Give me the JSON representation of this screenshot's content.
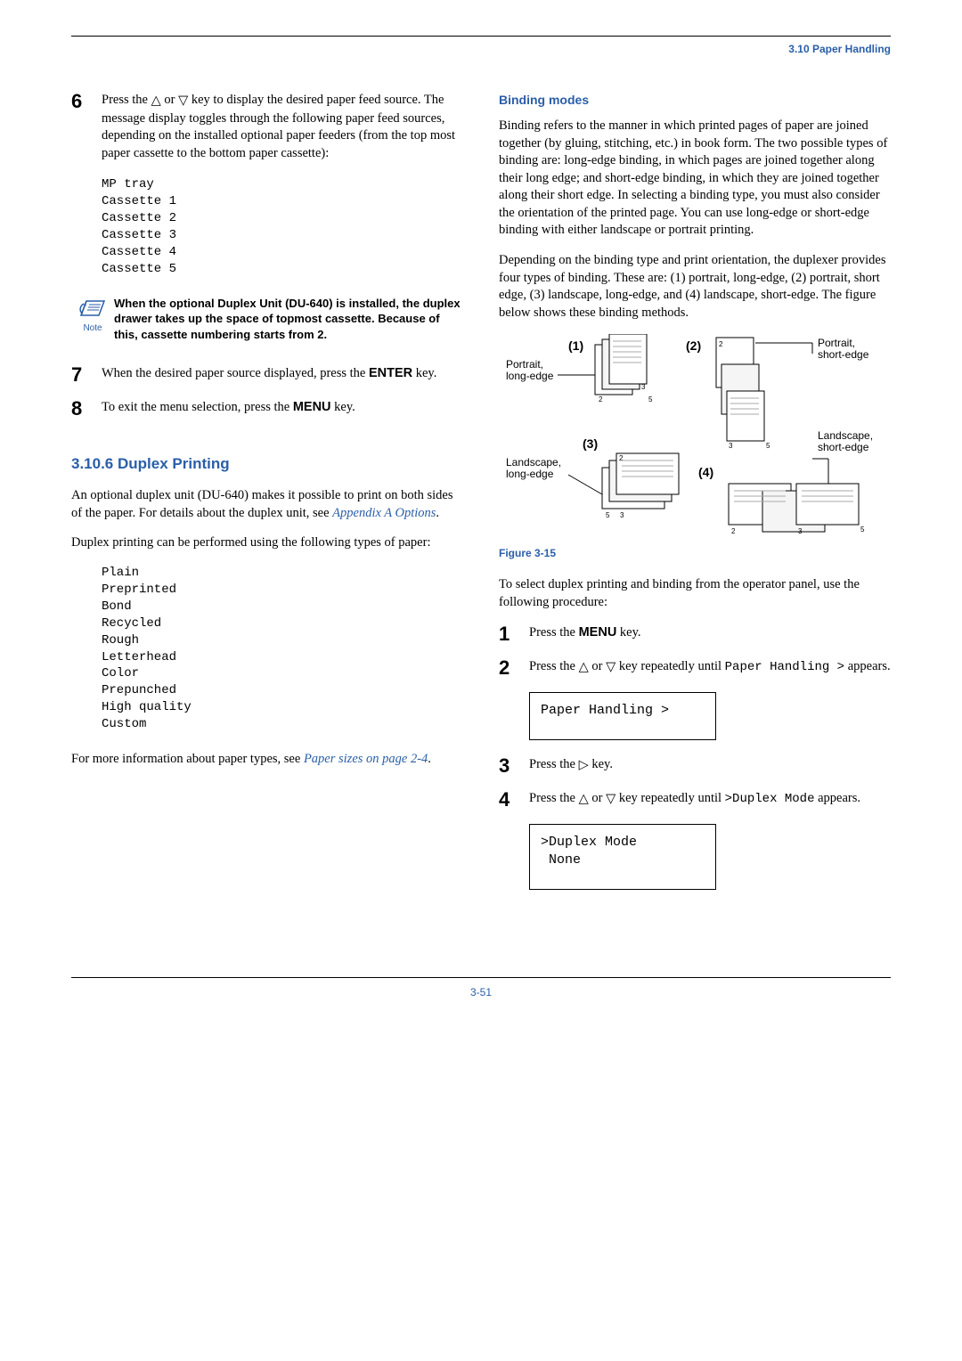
{
  "header": {
    "section": "3.10 Paper Handling"
  },
  "left": {
    "step6": {
      "num": "6",
      "text_a": "Press the ",
      "text_b": " or ",
      "text_c": " key to display the desired paper feed source. The message display toggles through the following paper feed sources, depending on the installed optional paper feeders (from the top most paper cassette to the bottom paper cassette):"
    },
    "feed_sources": "MP tray\nCassette 1\nCassette 2\nCassette 3\nCassette 4\nCassette 5",
    "note": {
      "label": "Note",
      "text": "When the optional Duplex Unit (DU-640) is installed, the duplex drawer takes up the space of topmost cassette. Because of this, cassette numbering starts from 2."
    },
    "step7": {
      "num": "7",
      "text_a": "When the desired paper source displayed, press the ",
      "key": "ENTER",
      "text_b": " key."
    },
    "step8": {
      "num": "8",
      "text_a": "To exit the menu selection, press the ",
      "key": "MENU",
      "text_b": " key."
    },
    "h2": "3.10.6   Duplex Printing",
    "p1_a": "An optional duplex unit (DU-640) makes it possible to print on both sides of the paper. For details about the duplex unit, see ",
    "p1_link": "Appendix A Options",
    "p1_b": ".",
    "p2": "Duplex printing can be performed using the following types of paper:",
    "paper_types": "Plain\nPreprinted\nBond\nRecycled\nRough\nLetterhead\nColor\nPrepunched\nHigh quality\nCustom",
    "p3_a": "For more information about paper types, see ",
    "p3_link": "Paper sizes on page 2-4",
    "p3_b": "."
  },
  "right": {
    "h3": "Binding modes",
    "p1": "Binding refers to the manner in which printed pages of paper are joined together (by gluing, stitching, etc.) in book form. The two possible types of binding are: long-edge binding, in which pages are joined together along their long edge; and short-edge binding, in which they are joined together along their short edge. In selecting a binding type, you must also consider the orientation of the printed page. You can use long-edge or short-edge binding with either landscape or portrait printing.",
    "p2": "Depending on the binding type and print orientation, the duplexer provides four types of binding. These are: (1) portrait, long-edge, (2) portrait, short edge, (3) landscape, long-edge, and (4) landscape, short-edge. The figure below shows these binding methods.",
    "figure": {
      "n1": "(1)",
      "n2": "(2)",
      "n3": "(3)",
      "n4": "(4)",
      "lab1": "Portrait,\nlong-edge",
      "lab2": "Portrait,\nshort-edge",
      "lab3": "Landscape,\nlong-edge",
      "lab4": "Landscape,\nshort-edge",
      "marks": {
        "m2": "2",
        "m3": "3",
        "m5": "5"
      }
    },
    "figcap": "Figure 3-15",
    "p3": "To select duplex printing and binding from the operator panel, use the following procedure:",
    "step1": {
      "num": "1",
      "text_a": "Press the ",
      "key": "MENU",
      "text_b": " key."
    },
    "step2": {
      "num": "2",
      "text_a": "Press the ",
      "text_b": " or ",
      "text_c": " key repeatedly until ",
      "mono": "Paper Handling >",
      "text_d": " appears.",
      "lcd": "Paper Handling >"
    },
    "step3": {
      "num": "3",
      "text_a": "Press the ",
      "text_b": " key."
    },
    "step4": {
      "num": "4",
      "text_a": "Press the ",
      "text_b": " or ",
      "text_c": " key repeatedly until ",
      "mono": ">Duplex Mode",
      "text_d": " appears.",
      "lcd": ">Duplex Mode\n None"
    }
  },
  "footer": {
    "page": "3-51"
  },
  "icons": {
    "up": "△",
    "down": "▽",
    "right": "▷"
  }
}
